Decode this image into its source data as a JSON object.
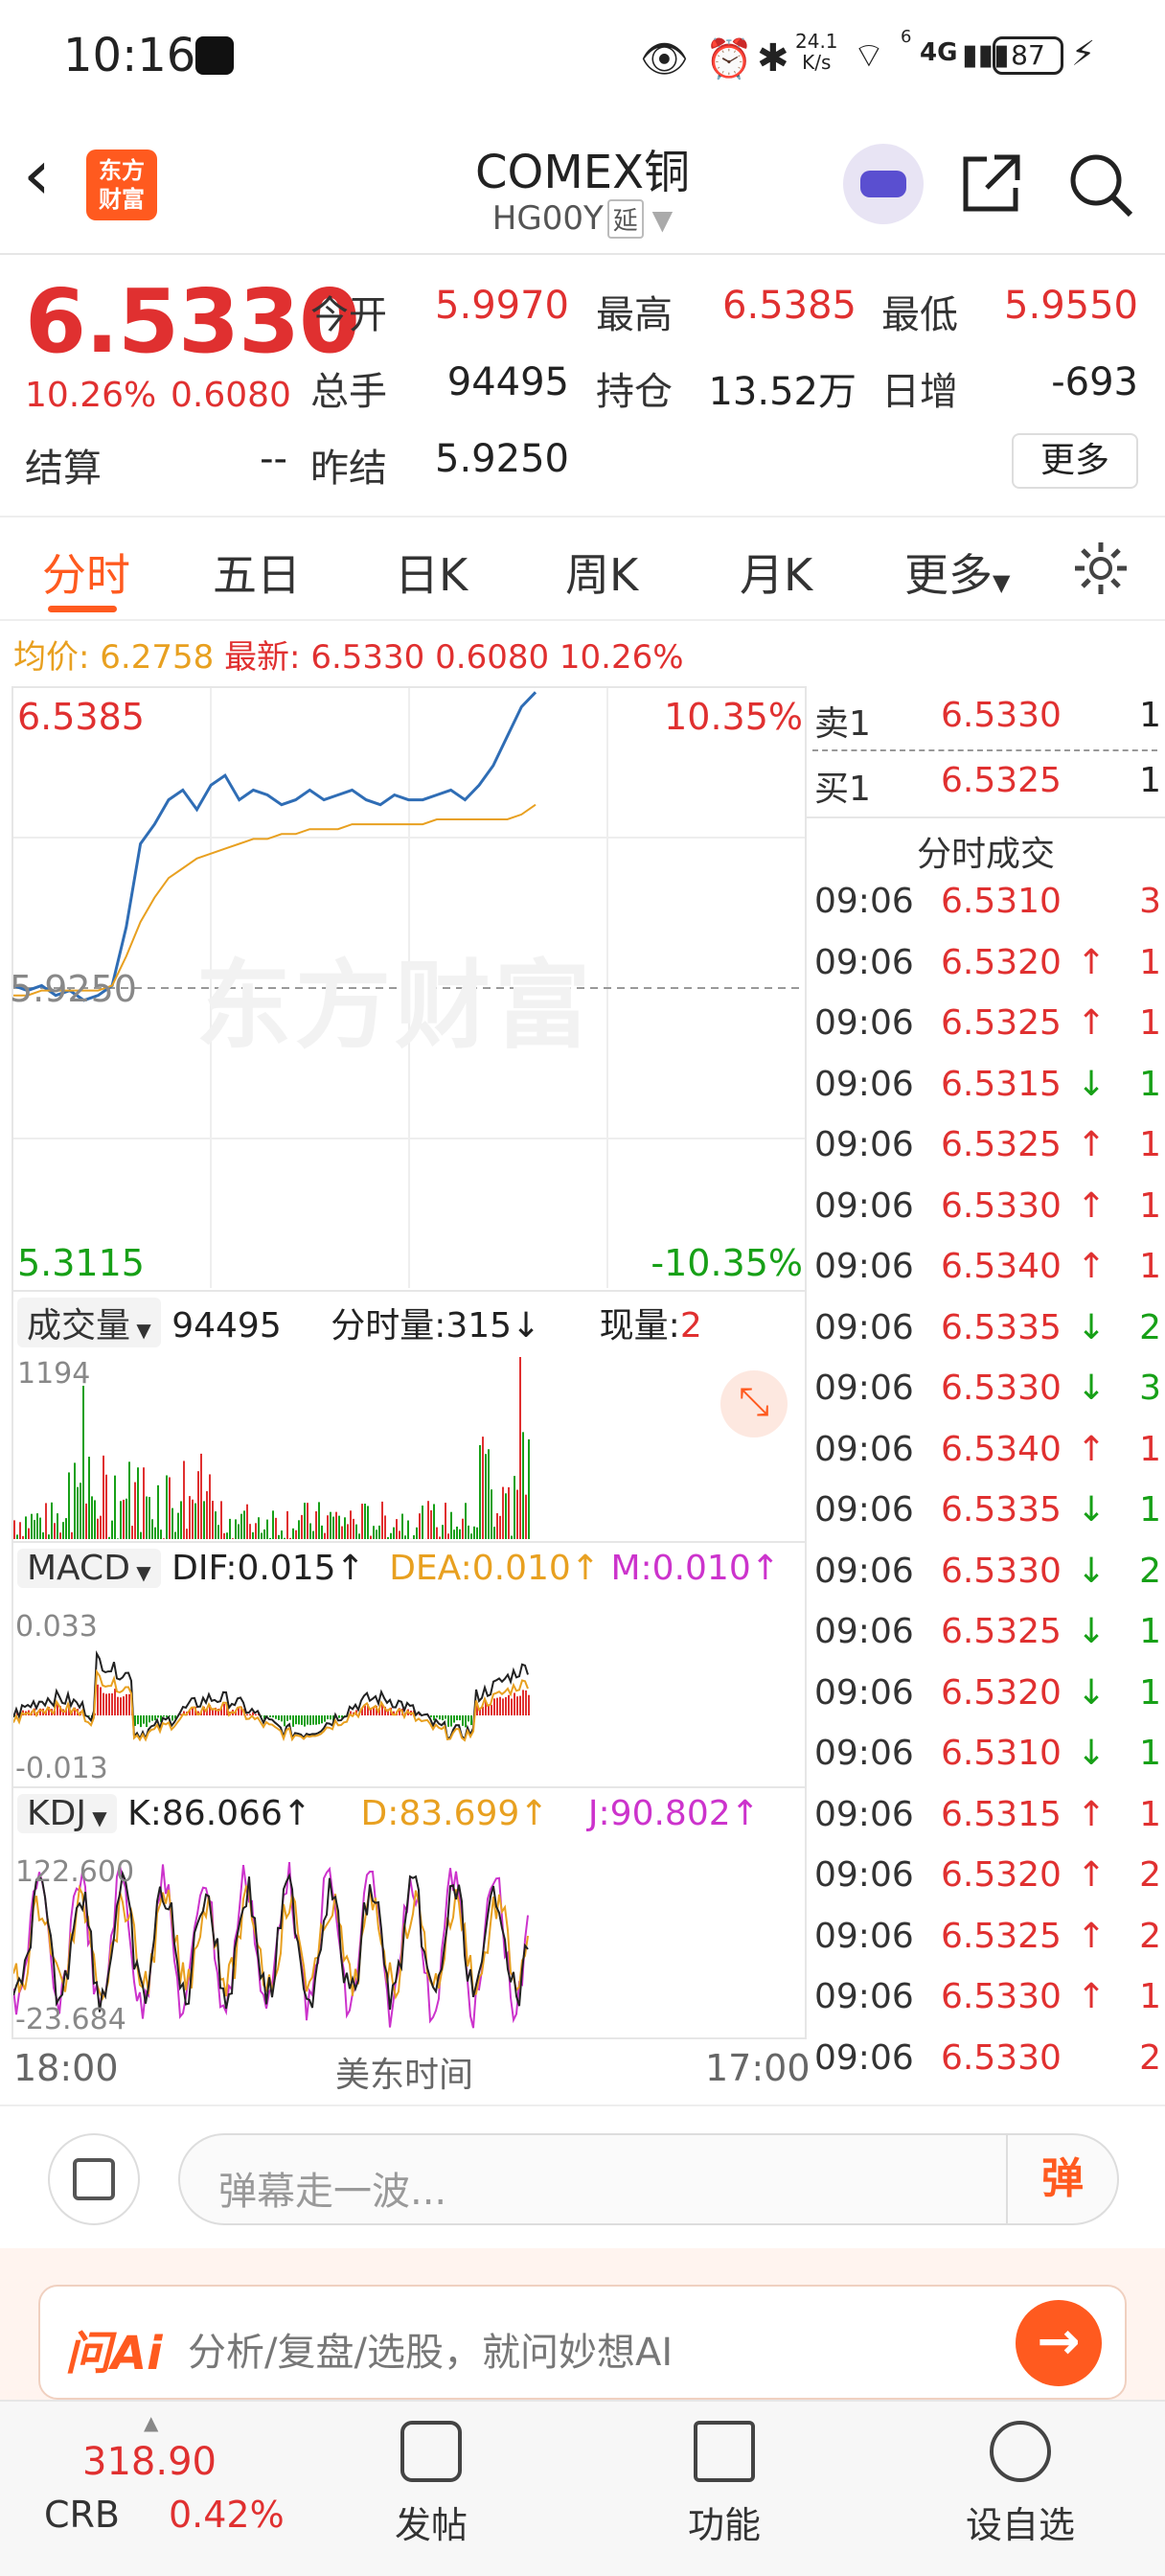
{
  "status": {
    "time": "10:16",
    "net_speed": "24.1\nK/s",
    "net_speed_top": "24.1",
    "net_speed_unit": "K/s",
    "wifi_label": "6",
    "signal": "4G",
    "battery": "87"
  },
  "nav": {
    "logo_text_1": "东方",
    "logo_text_2": "财富",
    "title": "COMEX铜",
    "code": "HG00Y",
    "delay_badge": "延"
  },
  "quote": {
    "price": "6.5330",
    "change_pct": "10.26%",
    "change": "0.6080",
    "open_label": "今开",
    "open": "5.9970",
    "high_label": "最高",
    "high": "6.5385",
    "low_label": "最低",
    "low": "5.9550",
    "volume_label": "总手",
    "volume": "94495",
    "oi_label": "持仓",
    "oi": "13.52万",
    "daily_inc_label": "日增",
    "daily_inc": "-693",
    "settle_label": "结算",
    "settle": "--",
    "prev_settle_label": "昨结",
    "prev_settle": "5.9250",
    "more_btn": "更多"
  },
  "tabs": [
    "分时",
    "五日",
    "日K",
    "周K",
    "月K",
    "更多"
  ],
  "avg_bar": {
    "avg_label": "均价:",
    "avg": "6.2758",
    "last_label": "最新:",
    "last": "6.5330",
    "change": "0.6080",
    "change_pct": "10.26%"
  },
  "chart": {
    "price_top": "6.5385",
    "pct_top": "10.35%",
    "price_mid": "5.9250",
    "price_bottom": "5.3115",
    "pct_bottom": "-10.35%",
    "watermark": "东方财富",
    "vol_label": "成交量",
    "vol_value": "94495",
    "tick_vol_label": "分时量:315↓",
    "cur_vol_label": "现量:",
    "cur_vol": "2",
    "vol_max": "1194",
    "macd_label": "MACD",
    "dif": "DIF:0.015↑",
    "dea": "DEA:0.010↑",
    "m": "M:0.010↑",
    "macd_top": "0.033",
    "macd_bottom": "-0.013",
    "kdj_label": "KDJ",
    "k": "K:86.066↑",
    "d": "D:83.699↑",
    "j": "J:90.802↑",
    "kdj_top": "122.600",
    "kdj_bottom": "-23.684",
    "x_start": "18:00",
    "x_mid": "美东时间",
    "x_end": "17:00"
  },
  "chart_data": {
    "type": "line",
    "title": "",
    "ylim": [
      5.3115,
      6.5385
    ],
    "series": [
      {
        "values": [
          5.93,
          5.92,
          5.93,
          5.91,
          5.92,
          5.9,
          5.91,
          5.93,
          6.05,
          6.22,
          6.26,
          6.31,
          6.33,
          6.29,
          6.34,
          6.36,
          6.31,
          6.33,
          6.32,
          6.3,
          6.31,
          6.33,
          6.31,
          6.32,
          6.33,
          6.31,
          6.3,
          6.32,
          6.31,
          6.31,
          6.32,
          6.33,
          6.31,
          6.34,
          6.38,
          6.44,
          6.5,
          6.53
        ]
      },
      {
        "values": [
          5.91,
          5.91,
          5.92,
          5.92,
          5.92,
          5.92,
          5.92,
          5.93,
          5.99,
          6.06,
          6.11,
          6.15,
          6.17,
          6.19,
          6.2,
          6.21,
          6.22,
          6.23,
          6.23,
          6.24,
          6.24,
          6.25,
          6.25,
          6.25,
          6.26,
          6.26,
          6.26,
          6.26,
          6.26,
          6.26,
          6.27,
          6.27,
          6.27,
          6.27,
          6.27,
          6.27,
          6.28,
          6.3
        ]
      }
    ]
  },
  "sell1": {
    "label": "卖1",
    "price": "6.5330",
    "vol": "1"
  },
  "buy1": {
    "label": "买1",
    "price": "6.5325",
    "vol": "1"
  },
  "trades_title": "分时成交",
  "trades": [
    {
      "time": "09:06",
      "price": "6.5310",
      "arrow": "",
      "vol": "3",
      "dir": "red"
    },
    {
      "time": "09:06",
      "price": "6.5320",
      "arrow": "↑",
      "vol": "1",
      "dir": "red"
    },
    {
      "time": "09:06",
      "price": "6.5325",
      "arrow": "↑",
      "vol": "1",
      "dir": "red"
    },
    {
      "time": "09:06",
      "price": "6.5315",
      "arrow": "↓",
      "vol": "1",
      "dir": "green"
    },
    {
      "time": "09:06",
      "price": "6.5325",
      "arrow": "↑",
      "vol": "1",
      "dir": "red"
    },
    {
      "time": "09:06",
      "price": "6.5330",
      "arrow": "↑",
      "vol": "1",
      "dir": "red"
    },
    {
      "time": "09:06",
      "price": "6.5340",
      "arrow": "↑",
      "vol": "1",
      "dir": "red"
    },
    {
      "time": "09:06",
      "price": "6.5335",
      "arrow": "↓",
      "vol": "2",
      "dir": "green"
    },
    {
      "time": "09:06",
      "price": "6.5330",
      "arrow": "↓",
      "vol": "3",
      "dir": "green"
    },
    {
      "time": "09:06",
      "price": "6.5340",
      "arrow": "↑",
      "vol": "1",
      "dir": "red"
    },
    {
      "time": "09:06",
      "price": "6.5335",
      "arrow": "↓",
      "vol": "1",
      "dir": "green"
    },
    {
      "time": "09:06",
      "price": "6.5330",
      "arrow": "↓",
      "vol": "2",
      "dir": "green"
    },
    {
      "time": "09:06",
      "price": "6.5325",
      "arrow": "↓",
      "vol": "1",
      "dir": "green"
    },
    {
      "time": "09:06",
      "price": "6.5320",
      "arrow": "↓",
      "vol": "1",
      "dir": "green"
    },
    {
      "time": "09:06",
      "price": "6.5310",
      "arrow": "↓",
      "vol": "1",
      "dir": "green"
    },
    {
      "time": "09:06",
      "price": "6.5315",
      "arrow": "↑",
      "vol": "1",
      "dir": "red"
    },
    {
      "time": "09:06",
      "price": "6.5320",
      "arrow": "↑",
      "vol": "2",
      "dir": "red"
    },
    {
      "time": "09:06",
      "price": "6.5325",
      "arrow": "↑",
      "vol": "2",
      "dir": "red"
    },
    {
      "time": "09:06",
      "price": "6.5330",
      "arrow": "↑",
      "vol": "1",
      "dir": "red"
    },
    {
      "time": "09:06",
      "price": "6.5330",
      "arrow": "",
      "vol": "2",
      "dir": "red"
    }
  ],
  "comment": {
    "placeholder": "弹幕走一波...",
    "dan_label": "弹"
  },
  "ai": {
    "logo": "问Ai",
    "placeholder": "分析/复盘/选股，就问妙想AI",
    "go": "→"
  },
  "bottom": {
    "index_value": "318.90",
    "index_name": "CRB",
    "index_pct": "0.42%",
    "post": "发帖",
    "func": "功能",
    "watch": "设自选"
  },
  "colors": {
    "up": "#e03030",
    "down": "#17a017",
    "accent": "#ff5a1f",
    "price_line": "#2f6db5",
    "avg_line": "#e8a020"
  }
}
